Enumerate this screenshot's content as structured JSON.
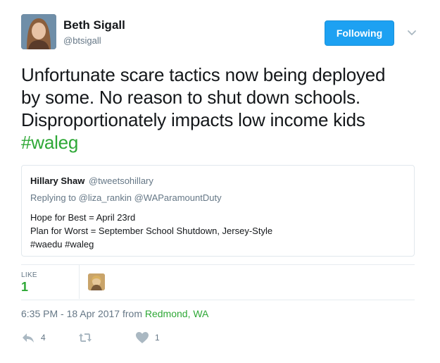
{
  "tweet": {
    "author_name": "Beth Sigall",
    "author_handle": "@btsigall",
    "follow_label": "Following",
    "text_lines": [
      "Unfortunate scare tactics now being deployed",
      "by some. No reason to shut down schools.",
      "Disproportionately impacts low income kids"
    ],
    "hashtag": "#waleg",
    "colors": {
      "accent": "#1da1f2",
      "link": "#2ea836",
      "muted": "#657786"
    }
  },
  "quote": {
    "author_name": "Hillary Shaw",
    "author_handle": "@tweetsohillary",
    "reply_line": "Replying to @liza_rankin @WAParamountDuty",
    "body_lines": [
      "Hope for Best = April 23rd",
      "Plan for Worst = September School Shutdown, Jersey-Style",
      "#waedu #waleg"
    ]
  },
  "stats": {
    "like_label": "LIKE",
    "like_count": "1"
  },
  "meta": {
    "timestamp": "6:35 PM - 18 Apr 2017 from ",
    "location": "Redmond, WA"
  },
  "actions": {
    "reply": {
      "icon": "reply-icon",
      "count": "4"
    },
    "retweet": {
      "icon": "retweet-icon",
      "count": ""
    },
    "like": {
      "icon": "heart-icon",
      "count": "1"
    }
  }
}
